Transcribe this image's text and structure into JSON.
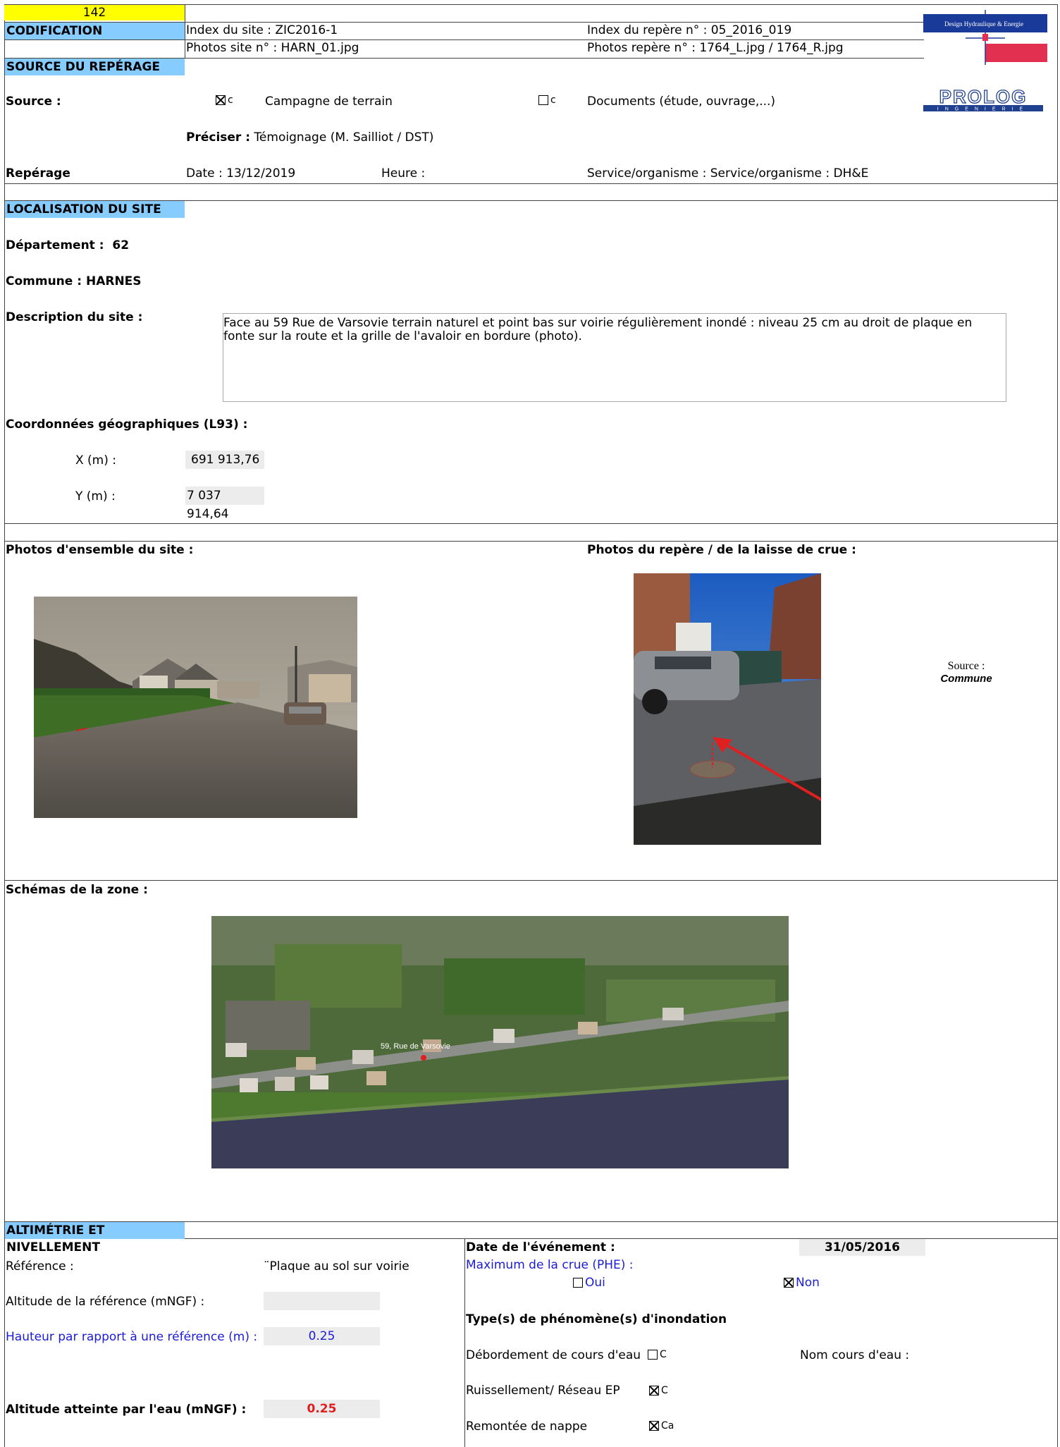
{
  "header": {
    "number": "142",
    "codification": "CODIFICATION",
    "site_index": "Index du site :  ZIC2016-1",
    "site_photos": "Photos site n° : HARN_01.jpg",
    "marker_index": "Index du repère n° : 05_2016_019",
    "marker_photos": "Photos repère n° : 1764_L.jpg  / 1764_R.jpg",
    "logo_dhe_text": "Design Hydraulique & Energie",
    "logo_prolog_text": "PROLOG",
    "logo_prolog_sub": "INGENIERIE"
  },
  "source_section": {
    "title": "SOURCE DU REPÉRAGE",
    "source_label": "Source :",
    "option1_mark": "c",
    "option1_label": "Campagne de terrain",
    "option2_mark": "c",
    "option2_label": "Documents (étude, ouvrage,...)",
    "preciser_label": "Préciser :",
    "preciser_value": " Témoignage  (M. Sailliot / DST)",
    "reperage_label": "Repérage",
    "date": "Date : 13/12/2019",
    "heure": "Heure :",
    "service": "Service/organisme : Service/organisme : DH&E"
  },
  "localisation": {
    "title": "LOCALISATION DU SITE",
    "departement_label": "Département :",
    "departement_value": "62",
    "commune_label": "Commune :",
    "commune_value": "HARNES",
    "description_label": "Description du site :",
    "description": "Face au 59 Rue de Varsovie terrain naturel et  point bas sur voirie régulièrement inondé : niveau 25 cm au droit de plaque en fonte sur la route et la grille de l'avaloir en bordure  (photo).",
    "coords_label": "Coordonnées géographiques (L93) :",
    "x_label": "X (m) :",
    "x_value": "691 913,76",
    "y_label": "Y (m) :",
    "y_value": "7 037 914,64"
  },
  "photos": {
    "site_label": "Photos d'ensemble du site :",
    "marker_label": "Photos du repère / de la laisse de crue  :",
    "source_label": "Source :",
    "source_value": "Commune",
    "schemas_label": "Schémas de la zone :",
    "map_label": "59, Rue de Varsovie"
  },
  "altimetrie": {
    "title": "ALTIMÉTRIE ET NIVELLEMENT",
    "reference_label": "Référence :",
    "reference_value": "¨Plaque au sol sur voirie",
    "alt_ref_label": "Altitude de la référence (mNGF)  :",
    "alt_ref_value": "",
    "hauteur_label": "Hauteur par rapport à une référence (m) :",
    "hauteur_value": "0.25",
    "alt_eau_label": "Altitude atteinte par l'eau (mNGF) :",
    "alt_eau_value": "0.25",
    "date_event_label": "Date de l'événement :",
    "date_event_value": "31/05/2016",
    "phe_label": "Maximum de la crue (PHE) :",
    "oui": "Oui",
    "non": "Non",
    "type_label": "Type(s) de phénomène(s) d'inondation",
    "debordement": "Débordement de cours d'eau",
    "debordement_mark": "C",
    "nom_cours": "Nom cours d'eau :",
    "ruissellement": "Ruissellement/ Réseau EP",
    "ruissellement_mark": "C",
    "remontee": "Remontée de nappe",
    "remontee_mark": "Ca"
  },
  "colors": {
    "section_bg": "#87ccff",
    "number_bg": "#ffff00",
    "value_red": "#e02020",
    "link_blue": "#1c1cd8"
  }
}
